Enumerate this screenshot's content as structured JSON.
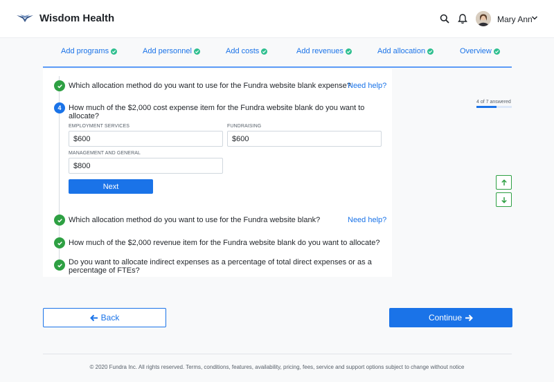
{
  "header": {
    "app_title": "Wisdom Health",
    "user_name": "Mary Ann",
    "icons": [
      "logo-icon",
      "search-icon",
      "bell-icon",
      "avatar",
      "chevron-down-icon"
    ]
  },
  "steps": [
    {
      "label": "Add programs",
      "status": "complete"
    },
    {
      "label": "Add personnel",
      "status": "complete"
    },
    {
      "label": "Add costs",
      "status": "complete"
    },
    {
      "label": "Add revenues",
      "status": "complete"
    },
    {
      "label": "Add allocation",
      "status": "complete"
    },
    {
      "label": "Overview",
      "status": "complete"
    }
  ],
  "questions": {
    "q1": {
      "text": "Which allocation method do you want to use for the Fundra website blank expense?",
      "help": "Need help?",
      "status": "answered"
    },
    "q4": {
      "number": "4",
      "text": "How much of the $2,000 cost expense item for the Fundra website blank do you want to allocate?",
      "fields": {
        "employment_label": "EMPLOYMENT SERVICES",
        "employment_value": "$600",
        "fundraising_label": "FUNDRAISING",
        "fundraising_value": "$600",
        "management_label": "MANAGEMENT AND GENERAL",
        "management_value": "$800"
      },
      "next_label": "Next"
    },
    "q5": {
      "text": "Which allocation method do you want to use for the Fundra website blank?",
      "help": "Need help?",
      "status": "answered"
    },
    "q6": {
      "text": "How much of the $2,000 revenue item for the Fundra website blank do you want to allocate?",
      "status": "answered"
    },
    "q7": {
      "text": "Do you want to allocate indirect expenses as a percentage of total direct expenses or as a percentage of FTEs?",
      "status": "answered"
    }
  },
  "progress": {
    "label": "4 of 7 answered",
    "fraction": 0.571
  },
  "nav": {
    "back_label": "Back",
    "continue_label": "Continue"
  },
  "footer": {
    "text": "© 2020 Fundra Inc. All rights reserved. Terms, conditions, features, availability, pricing, fees, service and support options subject to change without notice"
  },
  "colors": {
    "accent": "#1a73e8",
    "success": "#2ea043",
    "step_check": "#2fbf8f"
  }
}
